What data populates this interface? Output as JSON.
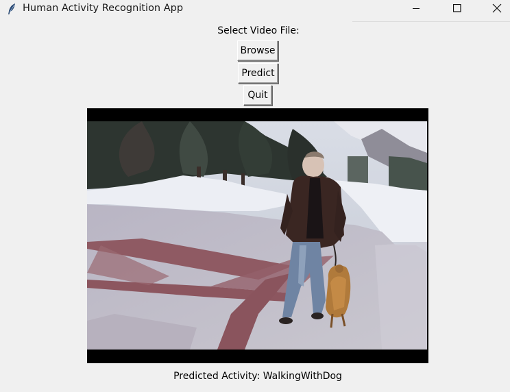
{
  "window": {
    "title": "Human Activity Recognition App",
    "icon": "feather-icon",
    "controls": [
      "minimize-icon",
      "maximize-icon",
      "close-icon"
    ]
  },
  "form": {
    "select_label": "Select Video File:",
    "browse_label": "Browse",
    "predict_label": "Predict",
    "quit_label": "Quit"
  },
  "video": {
    "content": "video-frame"
  },
  "result": {
    "prediction_text": "Predicted Activity: WalkingWithDog"
  }
}
